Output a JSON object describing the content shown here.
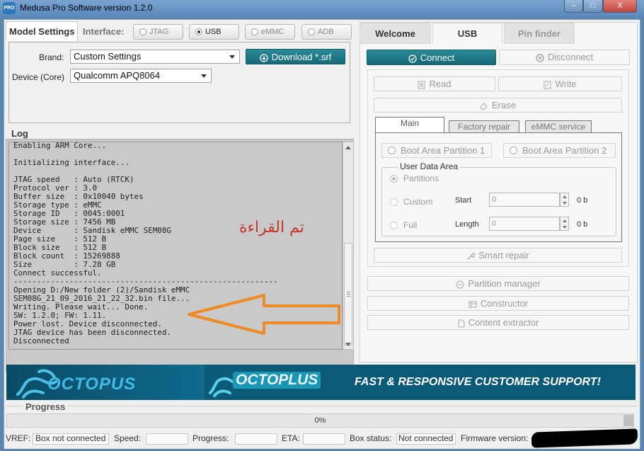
{
  "window": {
    "title": "Medusa Pro Software version 1.2.0",
    "icon_text": "PRO",
    "min": "–",
    "max": "□",
    "close": "X"
  },
  "model_settings": {
    "tab_label": "Model Settings",
    "interface_label": "Interface:",
    "interfaces": [
      {
        "label": "JTAG",
        "selected": false
      },
      {
        "label": "USB",
        "selected": true
      },
      {
        "label": "eMMC",
        "selected": false
      },
      {
        "label": "ADB",
        "selected": false
      }
    ],
    "brand_label": "Brand:",
    "brand_value": "Custom Settings",
    "device_label": "Device (Core)",
    "device_value": "Qualcomm APQ8064",
    "download_label": "Download *.srf"
  },
  "log": {
    "title": "Log",
    "lines": [
      "Enabling ARM Core...",
      "",
      "Initializing interface...",
      "",
      "JTAG speed   : Auto (RTCK)",
      "Protocol ver : 3.0",
      "Buffer size  : 0x10040 bytes",
      "Storage type : eMMC",
      "Storage ID   : 0045:0001",
      "Storage size : 7456 MB",
      "Device       : Sandisk eMMC SEM08G",
      "Page size    : 512 B",
      "Block size   : 512 B",
      "Block count  : 15269888",
      "Size         : 7.28 GB",
      "Connect successful.",
      "---------------------------------------------------------",
      "Opening D:/New folder (2)/Sandisk eMMC",
      "SEM08G_21_09_2016_21_22_32.bin file...",
      "Writing. Please wait... Done.",
      "SW: 1.2.0; FW: 1.11.",
      "Power lost. Device disconnected.",
      "JTAG device has been disconnected.",
      "Disconnected"
    ],
    "annotation_text": "تم القراءة",
    "annotation_color": "#c0392b",
    "arrow_color": "#f08a24"
  },
  "right_tabs": [
    {
      "label": "Welcome",
      "active": false
    },
    {
      "label": "USB",
      "active": true
    },
    {
      "label": "Pin finder",
      "active": false
    }
  ],
  "usb": {
    "connect_label": "Connect",
    "disconnect_label": "Disconnect",
    "read_label": "Read",
    "write_label": "Write",
    "erase_label": "Erase",
    "subtabs": [
      {
        "label": "Main",
        "active": true
      },
      {
        "label": "Factory repair",
        "active": false
      },
      {
        "label": "eMMC service",
        "active": false
      }
    ],
    "boot1_label": "Boot Area Partition 1",
    "boot2_label": "Boot Area Partition 2",
    "user_data_title": "User Data Area",
    "partitions_label": "Partitions",
    "custom_label": "Custom",
    "full_label": "Full",
    "start_label": "Start",
    "length_label": "Length",
    "start_value": "0",
    "length_value": "0",
    "start_unit": "0 b",
    "length_unit": "0 b",
    "smart_repair_label": "Smart repair",
    "partition_manager_label": "Partition manager",
    "constructor_label": "Constructor",
    "content_extractor_label": "Content extractor"
  },
  "banner": {
    "brand1": "OCTOPUS",
    "brand2": "OCTOPLUS",
    "tagline": "FAST & RESPONSIVE CUSTOMER SUPPORT!"
  },
  "progress": {
    "title": "Progress",
    "percent_text": "0%",
    "value": 0
  },
  "statusbar": {
    "vref_label": "VREF:",
    "vref_value": "Box not connected",
    "speed_label": "Speed:",
    "progress_label": "Progress:",
    "eta_label": "ETA:",
    "box_status_label": "Box status:",
    "box_status_value": "Not connected",
    "firmware_label": "Firmware version:"
  },
  "colors": {
    "teal": "#1e7d8b",
    "banner": "#0b5b78"
  }
}
